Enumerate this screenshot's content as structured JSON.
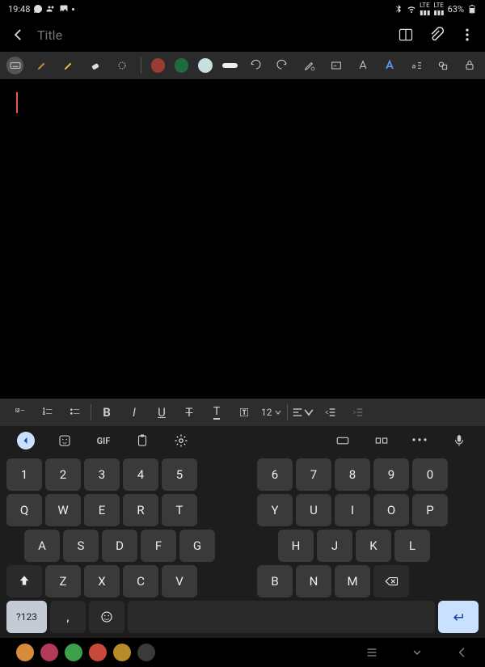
{
  "status": {
    "time": "19:48",
    "battery": "63%"
  },
  "title_bar": {
    "title": "Title"
  },
  "tool_colors": [
    "#9a3c2f",
    "#1f6a3f",
    "#c8e0e0"
  ],
  "format": {
    "size": "12"
  },
  "kb": {
    "gif": "GIF",
    "sym": "?123",
    "comma": ",",
    "row1_left": [
      "1",
      "2",
      "3",
      "4",
      "5"
    ],
    "row1_right": [
      "6",
      "7",
      "8",
      "9",
      "0"
    ],
    "row2_left": [
      "Q",
      "W",
      "E",
      "R",
      "T"
    ],
    "row2_right": [
      "Y",
      "U",
      "I",
      "O",
      "P"
    ],
    "row3_left": [
      "A",
      "S",
      "D",
      "F",
      "G"
    ],
    "row3_right": [
      "H",
      "J",
      "K",
      "L"
    ],
    "row4_left": [
      "Z",
      "X",
      "C",
      "V"
    ],
    "row4_right": [
      "B",
      "N",
      "M"
    ]
  },
  "dock_colors": [
    "#d88b3a",
    "#b43a5a",
    "#3ca04a",
    "#c94a3a",
    "#b88a2a",
    "#3a3a3a"
  ]
}
